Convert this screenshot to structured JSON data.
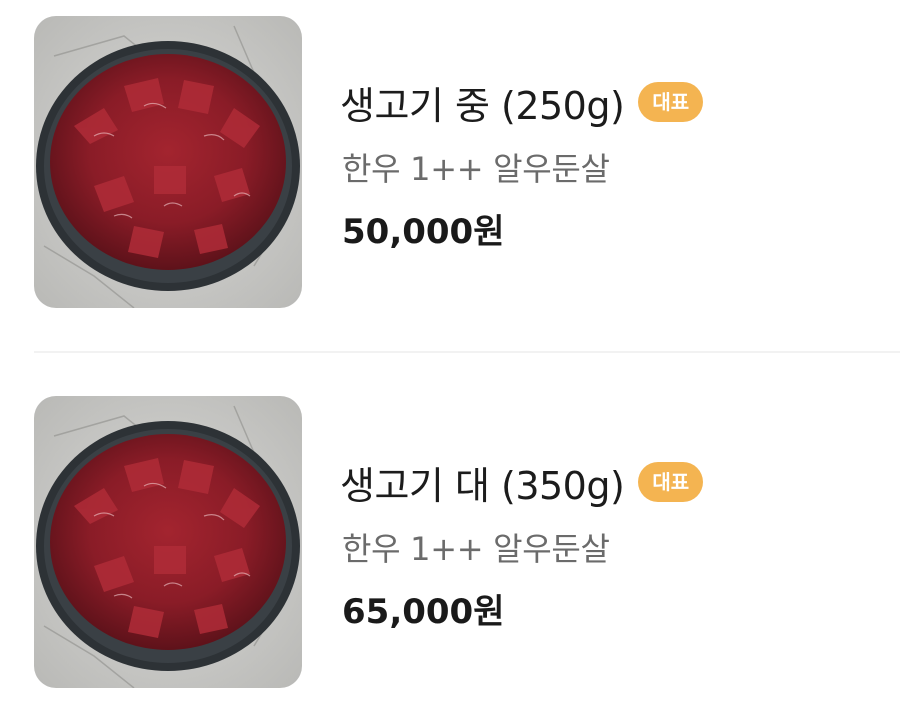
{
  "items": [
    {
      "title": "생고기 중 (250g)",
      "badge": "대표",
      "description": "한우 1++ 알우둔살",
      "price": "50,000원",
      "image": "raw-beef-plate"
    },
    {
      "title": "생고기 대 (350g)",
      "badge": "대표",
      "description": "한우 1++ 알우둔살",
      "price": "65,000원",
      "image": "raw-beef-plate"
    }
  ],
  "colors": {
    "badge": "#f4b451",
    "title": "#1c1c1c",
    "description": "#6b6b6b",
    "price": "#1a1a1a",
    "divider": "#f2f2f2"
  }
}
